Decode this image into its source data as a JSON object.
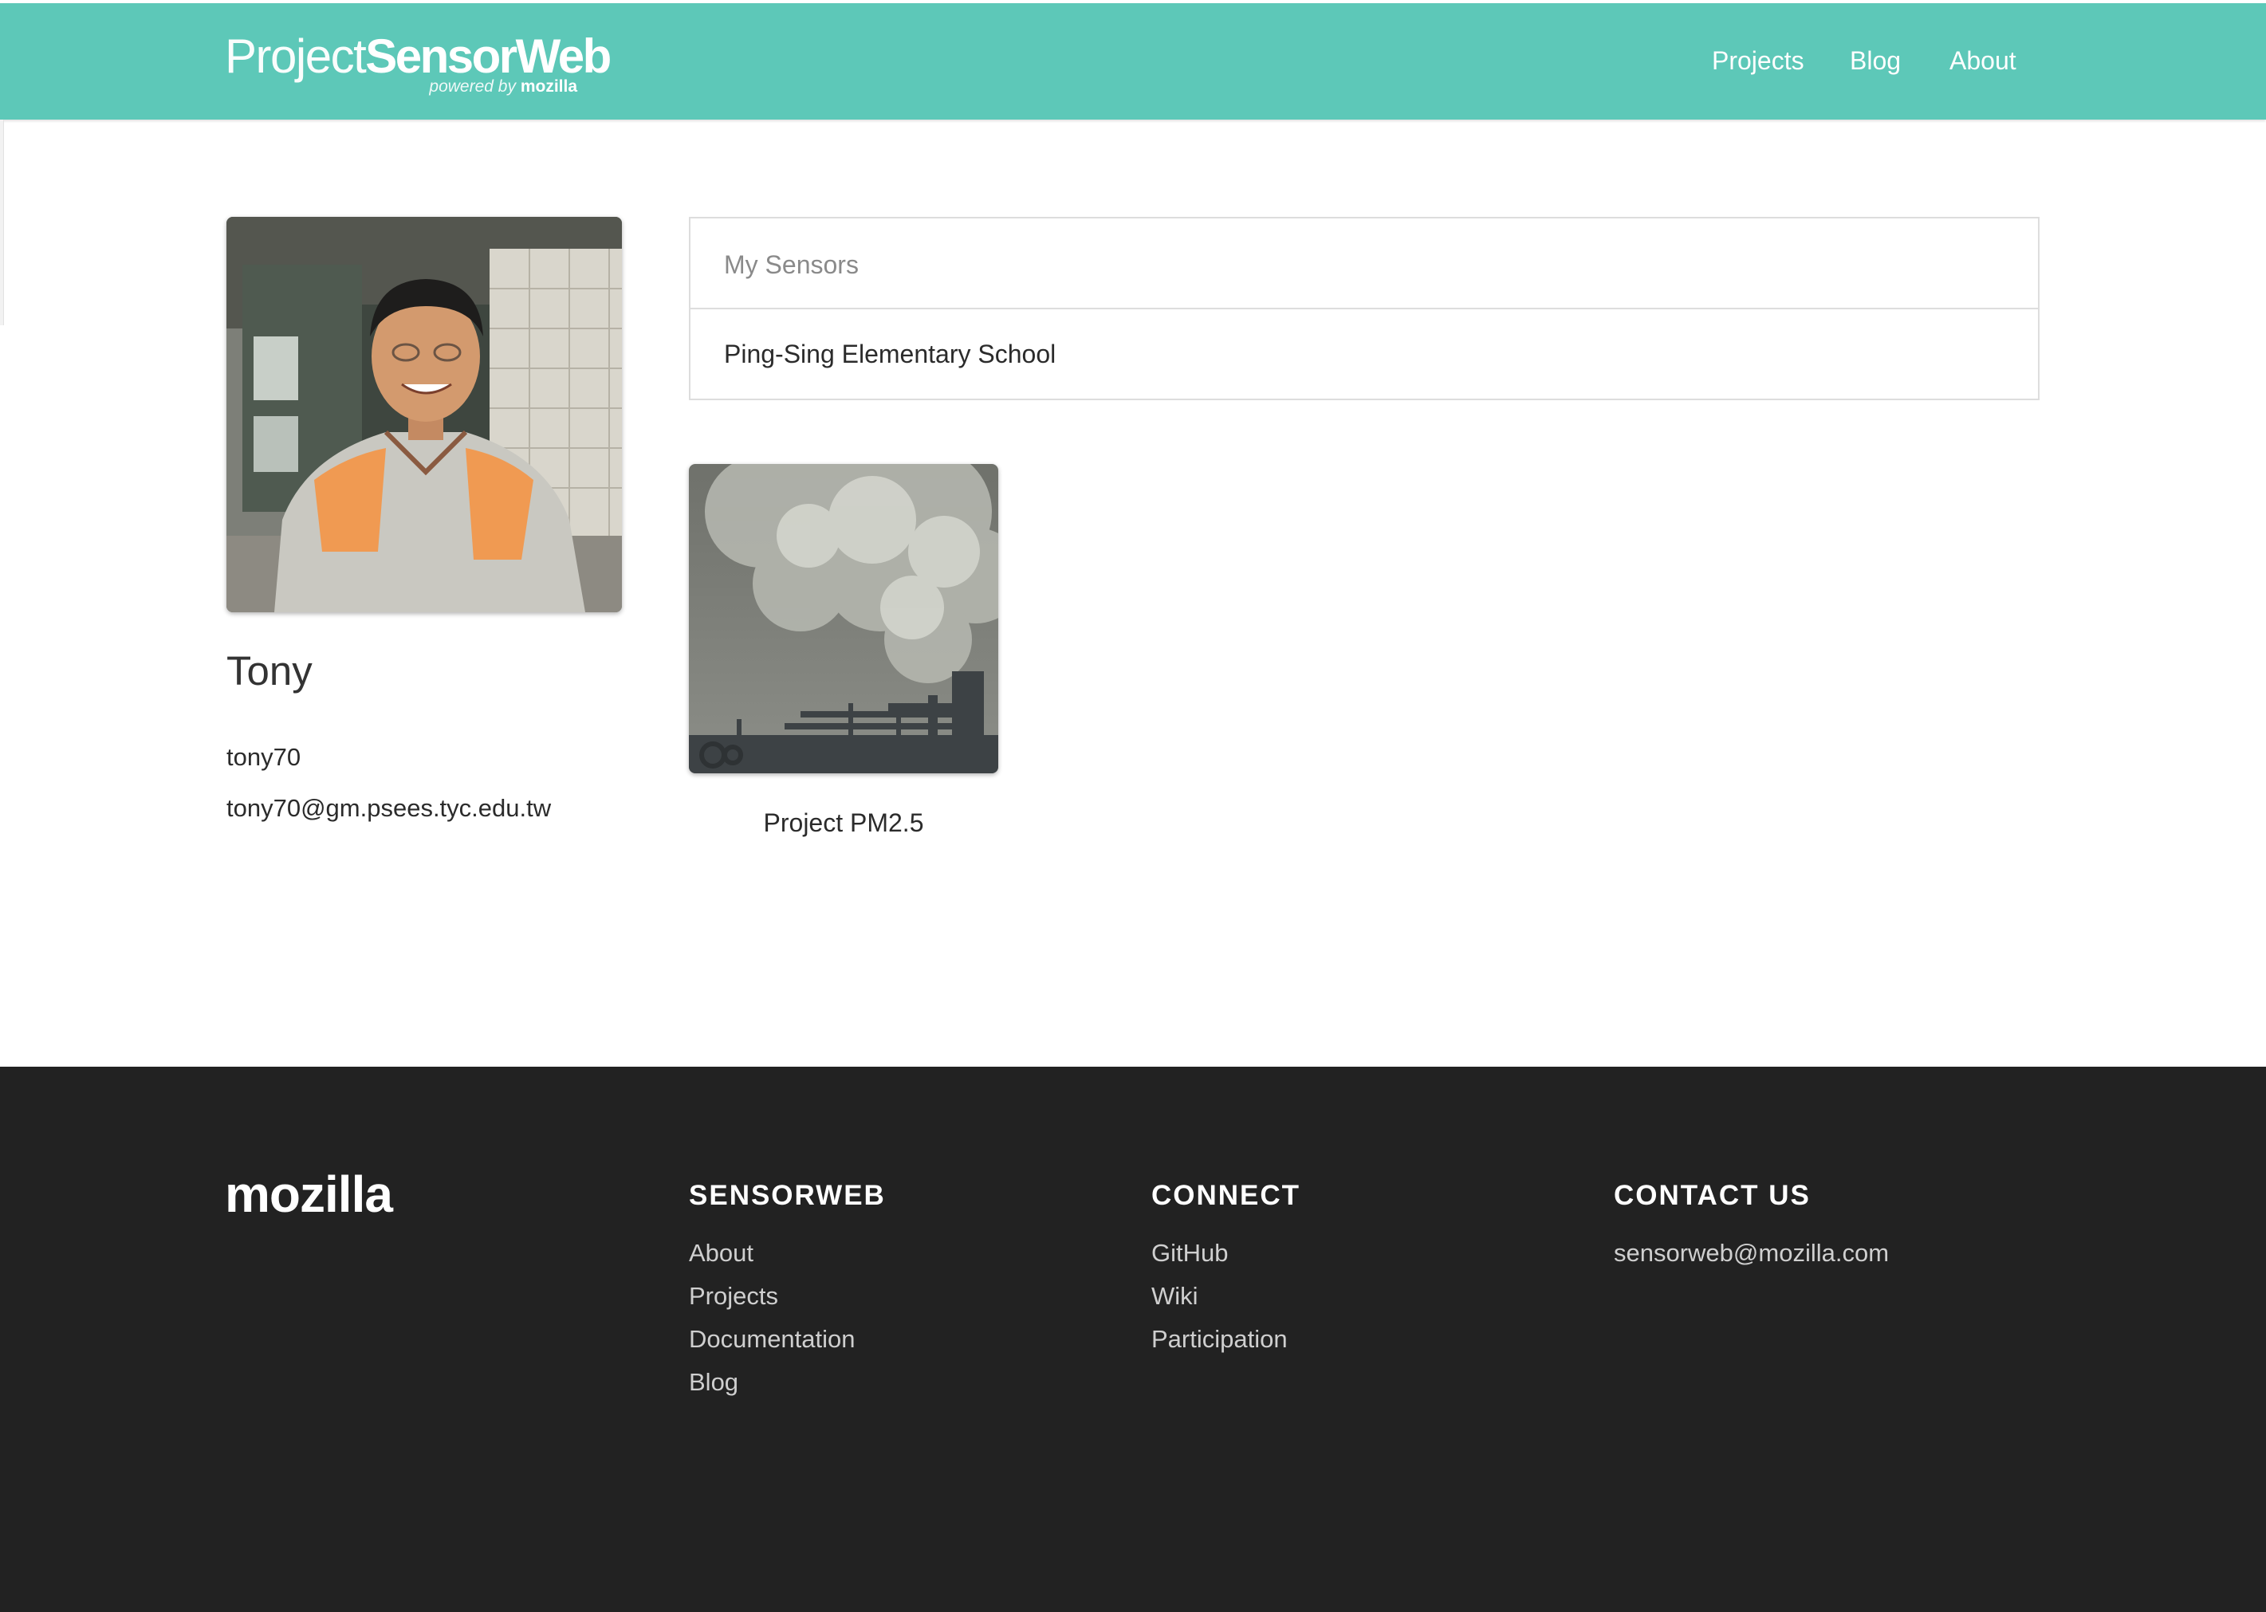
{
  "brand": {
    "name_light": "Project",
    "name_bold": "SensorWeb",
    "powered_prefix": "powered by",
    "powered_brand": "mozilla"
  },
  "nav": {
    "items": [
      {
        "label": "Projects"
      },
      {
        "label": "Blog"
      },
      {
        "label": "About"
      }
    ]
  },
  "profile": {
    "name": "Tony",
    "username": "tony70",
    "email": "tony70@gm.psees.tyc.edu.tw"
  },
  "sensors": {
    "title": "My Sensors",
    "items": [
      {
        "label": "Ping-Sing Elementary School"
      }
    ]
  },
  "projects": [
    {
      "title": "Project PM2.5"
    }
  ],
  "footer": {
    "logo": "mozilla",
    "columns": [
      {
        "heading": "SENSORWEB",
        "links": [
          "About",
          "Projects",
          "Documentation",
          "Blog"
        ]
      },
      {
        "heading": "CONNECT",
        "links": [
          "GitHub",
          "Wiki",
          "Participation"
        ]
      },
      {
        "heading": "CONTACT US",
        "links": [
          "sensorweb@mozilla.com"
        ]
      }
    ]
  },
  "colors": {
    "header_bg": "#5dc8b8",
    "footer_bg": "#222222",
    "panel_border": "#dddddd"
  }
}
